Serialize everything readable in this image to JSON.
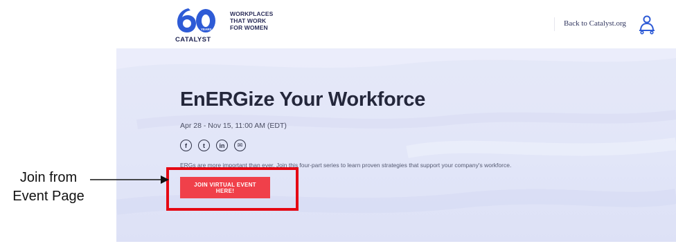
{
  "header": {
    "logo": {
      "number": "60",
      "years": "YEARS",
      "brand": "CATALYST",
      "colors": {
        "blue": "#2e5bd6",
        "navy": "#1d2150"
      }
    },
    "tagline": "WORKPLACES\nTHAT WORK\nFOR WOMEN",
    "back_link": "Back to Catalyst.org",
    "user_icon": "user-icon"
  },
  "hero": {
    "title": "EnERGize Your Workforce",
    "date": "Apr 28 - Nov 15, 11:00 AM (EDT)",
    "social": [
      {
        "name": "facebook",
        "glyph": "f"
      },
      {
        "name": "twitter",
        "glyph": "t"
      },
      {
        "name": "linkedin",
        "glyph": "in"
      },
      {
        "name": "email",
        "glyph": "✉"
      }
    ],
    "description": "ERGs are more important than ever. Join this four-part series to learn proven strategies that support your company's workforce.",
    "cta_label": "JOIN VIRTUAL EVENT HERE!",
    "background_color": "#e3e6f8",
    "cta_color": "#f0404a"
  },
  "annotation": {
    "text": "Join from\nEvent Page",
    "highlight_color": "#e50914"
  }
}
